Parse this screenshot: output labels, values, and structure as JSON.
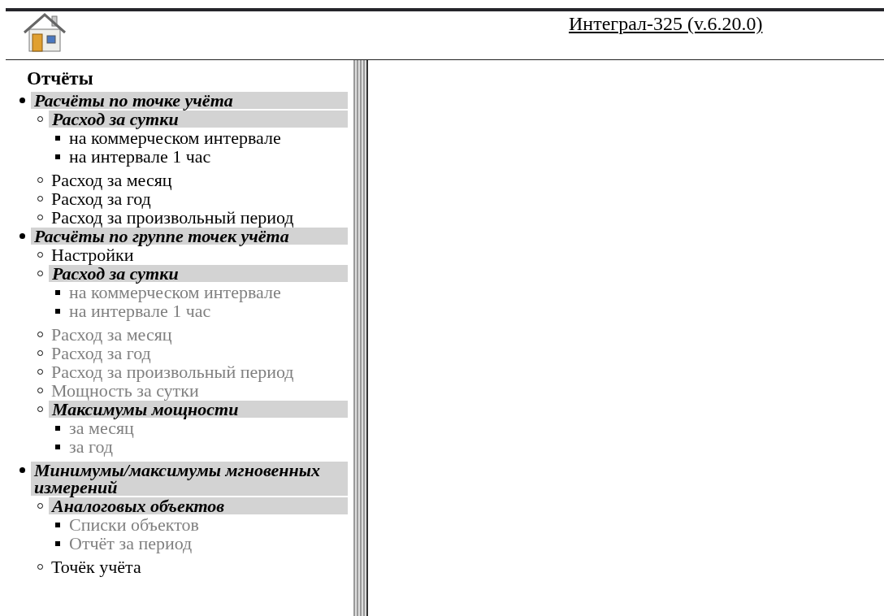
{
  "header": {
    "title": "Интеграл-325 (v.6.20.0)"
  },
  "sidebar": {
    "heading": "Отчёты",
    "items": [
      {
        "label": "Расчёты по точке учёта",
        "kind": "group",
        "disabled": false,
        "children": [
          {
            "label": "Расход за сутки",
            "kind": "group",
            "disabled": false,
            "children": [
              {
                "label": "на коммерческом интервале",
                "kind": "link",
                "disabled": false
              },
              {
                "label": "на интервале 1 час",
                "kind": "link",
                "disabled": false
              }
            ]
          },
          {
            "label": "Расход за месяц",
            "kind": "link",
            "disabled": false
          },
          {
            "label": "Расход за год",
            "kind": "link",
            "disabled": false
          },
          {
            "label": "Расход за произвольный период",
            "kind": "link",
            "disabled": false
          }
        ]
      },
      {
        "label": "Расчёты по группе точек учёта",
        "kind": "group",
        "disabled": false,
        "children": [
          {
            "label": "Настройки",
            "kind": "link",
            "disabled": false
          },
          {
            "label": "Расход за сутки",
            "kind": "group",
            "disabled": false,
            "children": [
              {
                "label": "на коммерческом интервале",
                "kind": "link",
                "disabled": true
              },
              {
                "label": "на интервале 1 час",
                "kind": "link",
                "disabled": true
              }
            ]
          },
          {
            "label": "Расход за месяц",
            "kind": "link",
            "disabled": true
          },
          {
            "label": "Расход за год",
            "kind": "link",
            "disabled": true
          },
          {
            "label": "Расход за произвольный период",
            "kind": "link",
            "disabled": true
          },
          {
            "label": "Мощность за сутки",
            "kind": "link",
            "disabled": true
          },
          {
            "label": "Максимумы мощности",
            "kind": "group",
            "disabled": false,
            "children": [
              {
                "label": "за месяц",
                "kind": "link",
                "disabled": true
              },
              {
                "label": "за год",
                "kind": "link",
                "disabled": true
              }
            ]
          }
        ]
      },
      {
        "label": "Минимумы/максимумы мгновенных измерений",
        "kind": "group",
        "disabled": false,
        "children": [
          {
            "label": "Аналоговых объектов",
            "kind": "group",
            "disabled": false,
            "children": [
              {
                "label": "Списки объектов",
                "kind": "link",
                "disabled": true
              },
              {
                "label": "Отчёт за период",
                "kind": "link",
                "disabled": true
              }
            ]
          },
          {
            "label": "Точёк учёта",
            "kind": "link",
            "disabled": false
          }
        ]
      }
    ]
  }
}
